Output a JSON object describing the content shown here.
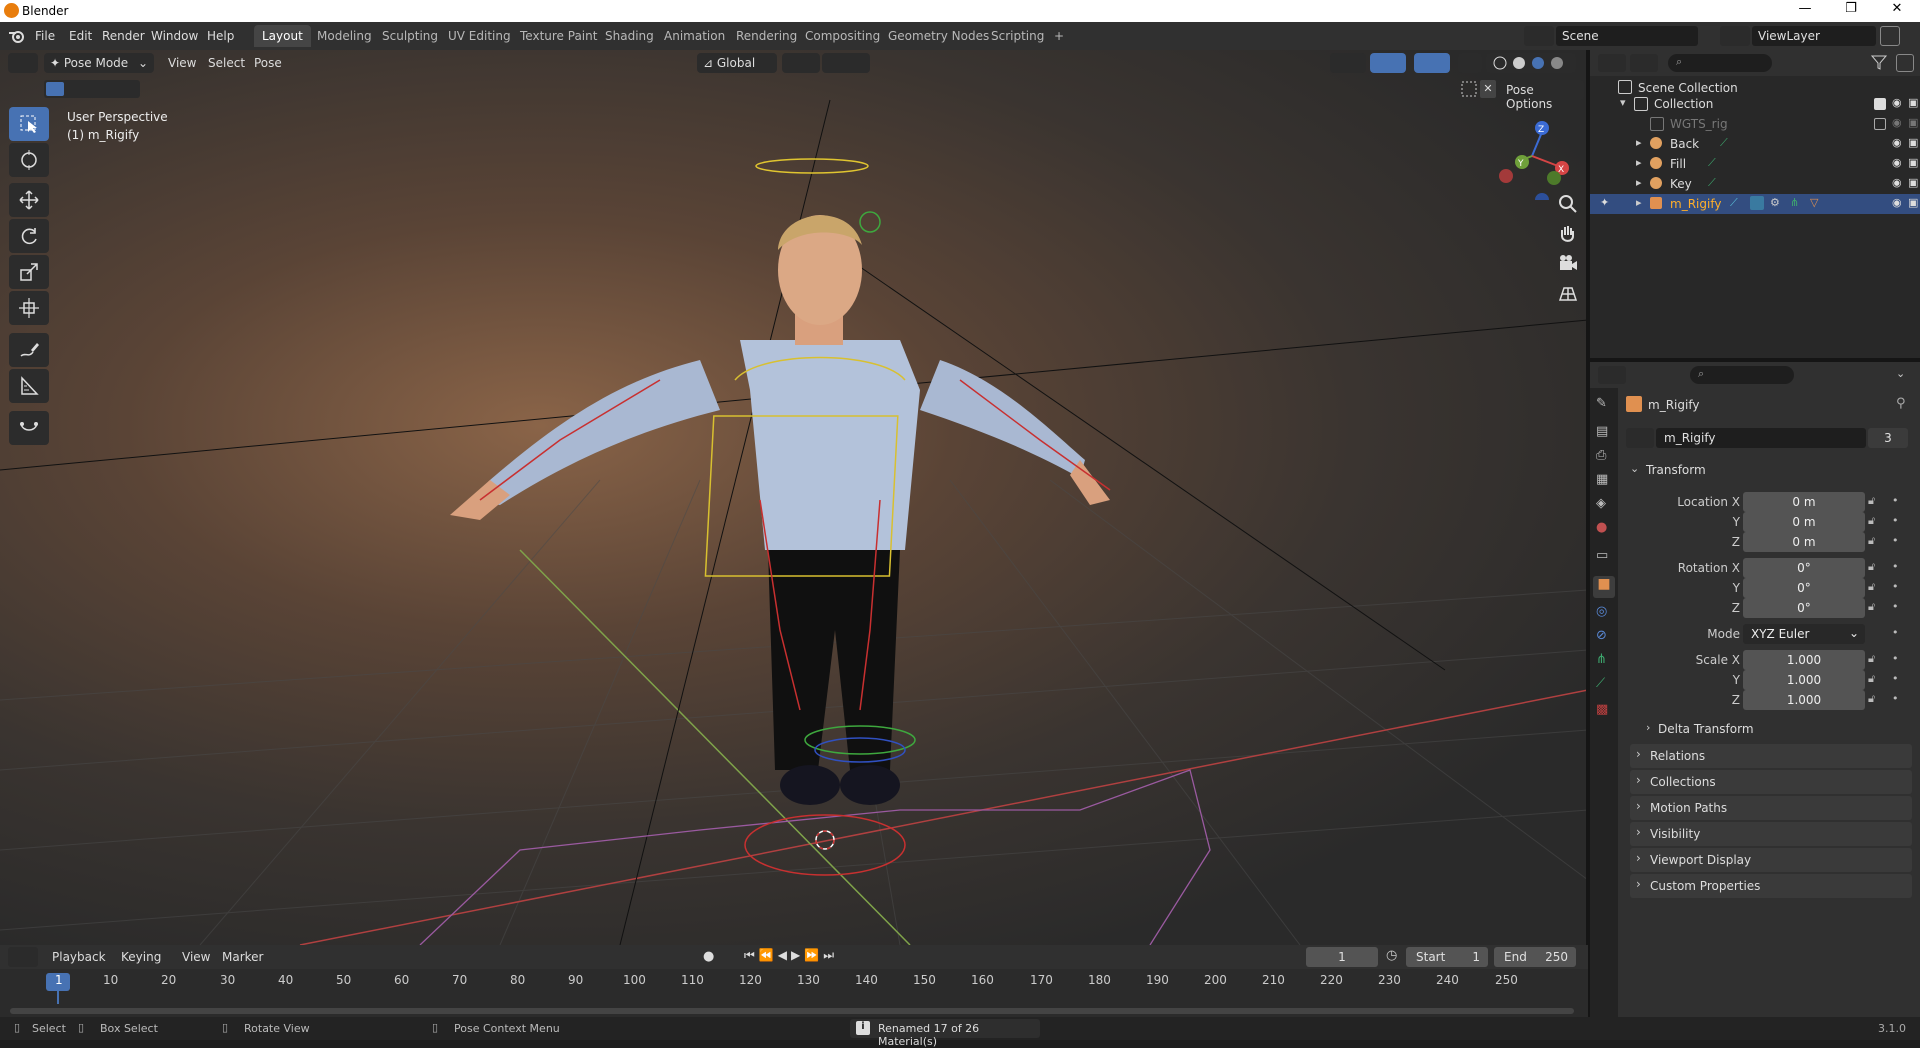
{
  "window": {
    "title": "Blender",
    "controls": [
      "—",
      "❐",
      "✕"
    ]
  },
  "menubar": {
    "menus": [
      "File",
      "Edit",
      "Render",
      "Window",
      "Help"
    ],
    "workspaces": [
      "Layout",
      "Modeling",
      "Sculpting",
      "UV Editing",
      "Texture Paint",
      "Shading",
      "Animation",
      "Rendering",
      "Compositing",
      "Geometry Nodes",
      "Scripting"
    ],
    "add_workspace": "+",
    "scene": "Scene",
    "view_layer": "ViewLayer"
  },
  "viewport_header": {
    "mode": "Pose Mode",
    "menus": [
      "View",
      "Select",
      "Pose"
    ],
    "transform_orientation": "Global",
    "pose_options": "Pose Options"
  },
  "viewport": {
    "perspective": "User Perspective",
    "object_info": "(1) m_Rigify",
    "gizmo_axes": [
      "Z",
      "Y",
      "X"
    ]
  },
  "outliner": {
    "root": "Scene Collection",
    "collection": "Collection",
    "items": [
      {
        "name": "WGTS_rig",
        "dim": true
      },
      {
        "name": "Back"
      },
      {
        "name": "Fill"
      },
      {
        "name": "Key"
      },
      {
        "name": "m_Rigify",
        "selected": true
      }
    ]
  },
  "properties": {
    "object_name": "m_Rigify",
    "datablock_name": "m_Rigify",
    "user_count": "3",
    "transform_title": "Transform",
    "location": {
      "label": "Location X",
      "x": "0 m",
      "y": "0 m",
      "z": "0 m"
    },
    "rotation": {
      "label": "Rotation X",
      "x": "0°",
      "y": "0°",
      "z": "0°"
    },
    "mode_label": "Mode",
    "mode_value": "XYZ Euler",
    "scale": {
      "label": "Scale X",
      "x": "1.000",
      "y": "1.000",
      "z": "1.000"
    },
    "axis_y": "Y",
    "axis_z": "Z",
    "delta_transform": "Delta Transform",
    "panels": [
      "Relations",
      "Collections",
      "Motion Paths",
      "Visibility",
      "Viewport Display",
      "Custom Properties"
    ]
  },
  "timeline": {
    "menus": [
      "Playback",
      "Keying",
      "View",
      "Marker"
    ],
    "current_frame": "1",
    "start_label": "Start",
    "start": "1",
    "end_label": "End",
    "end": "250",
    "ticks": [
      "1",
      "10",
      "20",
      "30",
      "40",
      "50",
      "60",
      "70",
      "80",
      "90",
      "100",
      "110",
      "120",
      "130",
      "140",
      "150",
      "160",
      "170",
      "180",
      "190",
      "200",
      "210",
      "220",
      "230",
      "240",
      "250"
    ]
  },
  "statusbar": {
    "select": "Select",
    "box_select": "Box Select",
    "rotate_view": "Rotate View",
    "pose_context_menu": "Pose Context Menu",
    "message": "Renamed 17 of 26 Material(s)",
    "version": "3.1.0"
  }
}
